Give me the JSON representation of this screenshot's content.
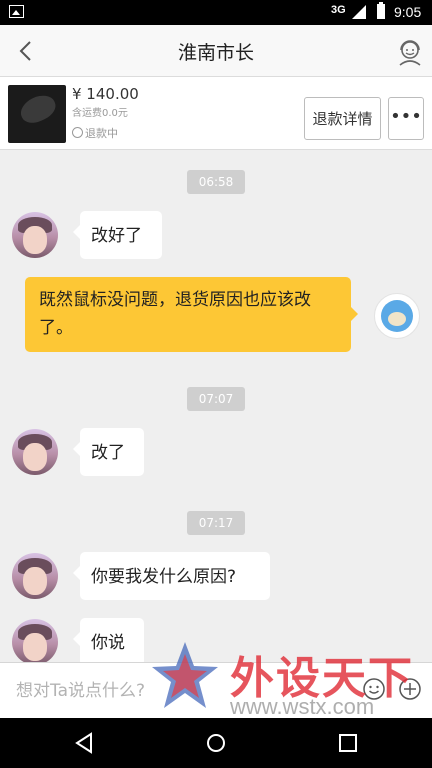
{
  "status_bar": {
    "network": "3G",
    "time": "9:05"
  },
  "header": {
    "title": "淮南市长",
    "back_icon": "back-chevron-icon",
    "profile_icon": "customer-service-icon"
  },
  "order": {
    "price": "¥ 140.00",
    "shipping": "含运费0.0元",
    "status": "退款中",
    "refund_button": "退款详情",
    "more_button": "•••"
  },
  "messages": [
    {
      "type": "timestamp",
      "text": "06:58"
    },
    {
      "type": "incoming",
      "text": "改好了"
    },
    {
      "type": "outgoing",
      "text": "既然鼠标没问题，退货原因也应该改了。"
    },
    {
      "type": "timestamp",
      "text": "07:07"
    },
    {
      "type": "incoming",
      "text": "改了"
    },
    {
      "type": "timestamp",
      "text": "07:17"
    },
    {
      "type": "incoming",
      "text": "你要我发什么原因?"
    },
    {
      "type": "incoming",
      "text": "你说"
    }
  ],
  "input": {
    "placeholder": "想对Ta说点什么?"
  },
  "watermark": {
    "title": "外设天下",
    "url": "www.wstx.com"
  },
  "colors": {
    "outgoing_bubble": "#fdc735",
    "background": "#efefef",
    "watermark": "#e1303a"
  }
}
